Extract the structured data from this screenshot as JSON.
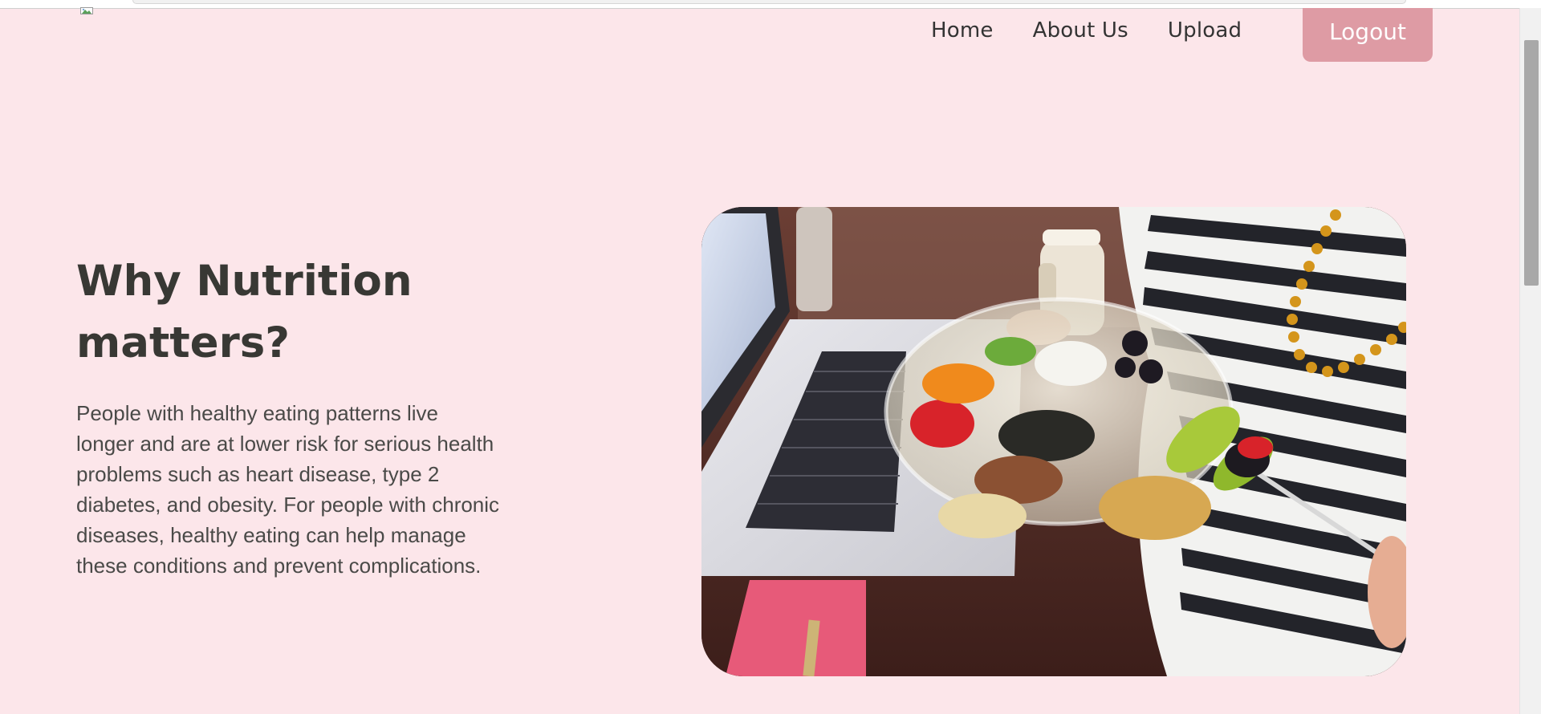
{
  "nav": {
    "items": [
      {
        "label": "Home"
      },
      {
        "label": "About Us"
      },
      {
        "label": "Upload"
      }
    ],
    "logout_label": "Logout"
  },
  "hero": {
    "title": "Why Nutrition matters?",
    "description": "People with healthy eating patterns live longer and are at lower risk for serious health problems such as heart disease, type 2 diabetes, and obesity. For people with chronic diseases, healthy eating can help manage these conditions and prevent complications.",
    "image_subject": "person holding salad bowl in front of laptop"
  },
  "colors": {
    "background": "#fce6ea",
    "logout_button": "#de9ba4",
    "heading_text": "#383834",
    "body_text": "#4a4a48"
  }
}
